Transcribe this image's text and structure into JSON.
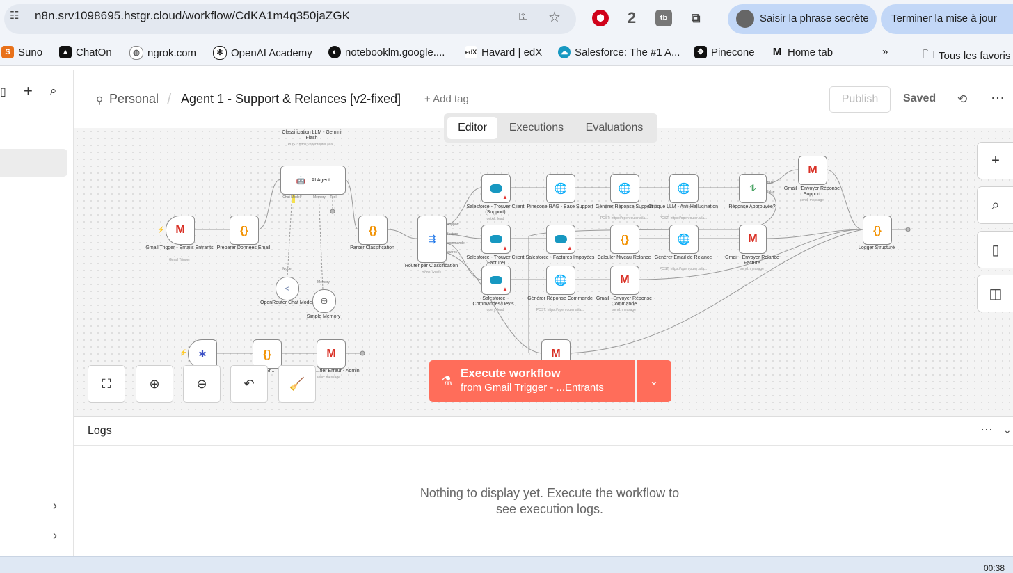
{
  "browser": {
    "url": "n8n.srv1098695.hstgr.cloud/workflow/CdKA1m4q350jaZGK",
    "ext_badge_count": "2",
    "ext_tb_label": "tb",
    "profile_label": "Saisir la phrase secrète",
    "update_label": "Terminer la mise à jour",
    "bookmarks": [
      "Suno",
      "ChatOn",
      "ngrok.com",
      "OpenAI Academy",
      "notebooklm.google....",
      "Havard | edX",
      "Salesforce: The #1 A...",
      "Pinecone",
      "Home tab"
    ],
    "bookmarks_more": "»",
    "all_bookmarks": "Tous les favoris"
  },
  "header": {
    "project": "Personal",
    "separator": "/",
    "title": "Agent 1 - Support & Relances [v2-fixed]",
    "add_tag": "+ Add tag",
    "publish": "Publish",
    "status": "Saved"
  },
  "tabs": [
    "Editor",
    "Executions",
    "Evaluations"
  ],
  "nodes": {
    "classif_llm": {
      "label": "Classification LLM - Gemini Flash",
      "sub": "POST: https://openrouter.ai/a..."
    },
    "ai_agent": {
      "label": "AI Agent",
      "ports": [
        "Chat Model*",
        "Memory",
        "Tool"
      ]
    },
    "gmail_trigger": {
      "label": "Gmail Trigger - Emails Entrants",
      "sub": "Gmail Trigger"
    },
    "prep_data": {
      "label": "Préparer Données Email"
    },
    "parser": {
      "label": "Parser Classification"
    },
    "router": {
      "label": "Router par Classification",
      "sub": "mode: Rules",
      "outputs": [
        "support",
        "facture",
        "commande",
        "autres"
      ]
    },
    "openrouter": {
      "label": "OpenRouter Chat Model",
      "port": "Model"
    },
    "memory": {
      "label": "Simple Memory",
      "port": "Memory"
    },
    "sf_support": {
      "label": "Salesforce - Trouver Client (Support)",
      "sub": "getAll: lead"
    },
    "sf_facture": {
      "label": "Salesforce - Trouver Client (Facture)",
      "sub": "getAll: lead"
    },
    "sf_commandes": {
      "label": "Salesforce - Commandes/Devis...",
      "sub": "query: lead"
    },
    "pinecone": {
      "label": "Pinecone RAG - Base Support"
    },
    "gen_support": {
      "label": "Générer Réponse Support",
      "sub": "POST: https://openrouter.ai/a..."
    },
    "critique": {
      "label": "Critique LLM - Anti-Hallucination",
      "sub": "POST: https://openrouter.ai/a..."
    },
    "approved": {
      "label": "Réponse Approuvée?",
      "outputs": [
        "true",
        "false"
      ]
    },
    "gmail_support": {
      "label": "Gmail - Envoyer Réponse Support",
      "sub": "send: message"
    },
    "sf_factures_imp": {
      "label": "Salesforce - Factures Impayées"
    },
    "calc_relance": {
      "label": "Calculer Niveau Relance"
    },
    "gen_relance": {
      "label": "Générer Email de Relance",
      "sub": "POST: https://openrouter.ai/a..."
    },
    "gmail_relance": {
      "label": "Gmail - Envoyer Relance Facture",
      "sub": "send: message"
    },
    "gen_commande": {
      "label": "Générer Réponse Commande",
      "sub": "POST: https://openrouter.ai/a..."
    },
    "gmail_commande": {
      "label": "Gmail - Envoyer Réponse Commande",
      "sub": "send: message"
    },
    "logger": {
      "label": "Logger Structuré"
    },
    "error_trigger": {
      "label": "E...al"
    },
    "error_code": {
      "label": "...re Er... ...tral"
    },
    "gmail_admin": {
      "label": "...fier Erreur - Admin",
      "sub": "send: message"
    }
  },
  "execute": {
    "title": "Execute workflow",
    "subtitle": "from Gmail Trigger - ...Entrants"
  },
  "logs": {
    "title": "Logs",
    "empty": "Nothing to display yet. Execute the workflow to see execution logs."
  },
  "taskbar": {
    "clock": "00:38"
  },
  "colors": {
    "accent": "#ff6d5a",
    "gmail": "#d93025",
    "code": "#f29100",
    "http": "#1a73e8",
    "salesforce": "#1798c1"
  }
}
